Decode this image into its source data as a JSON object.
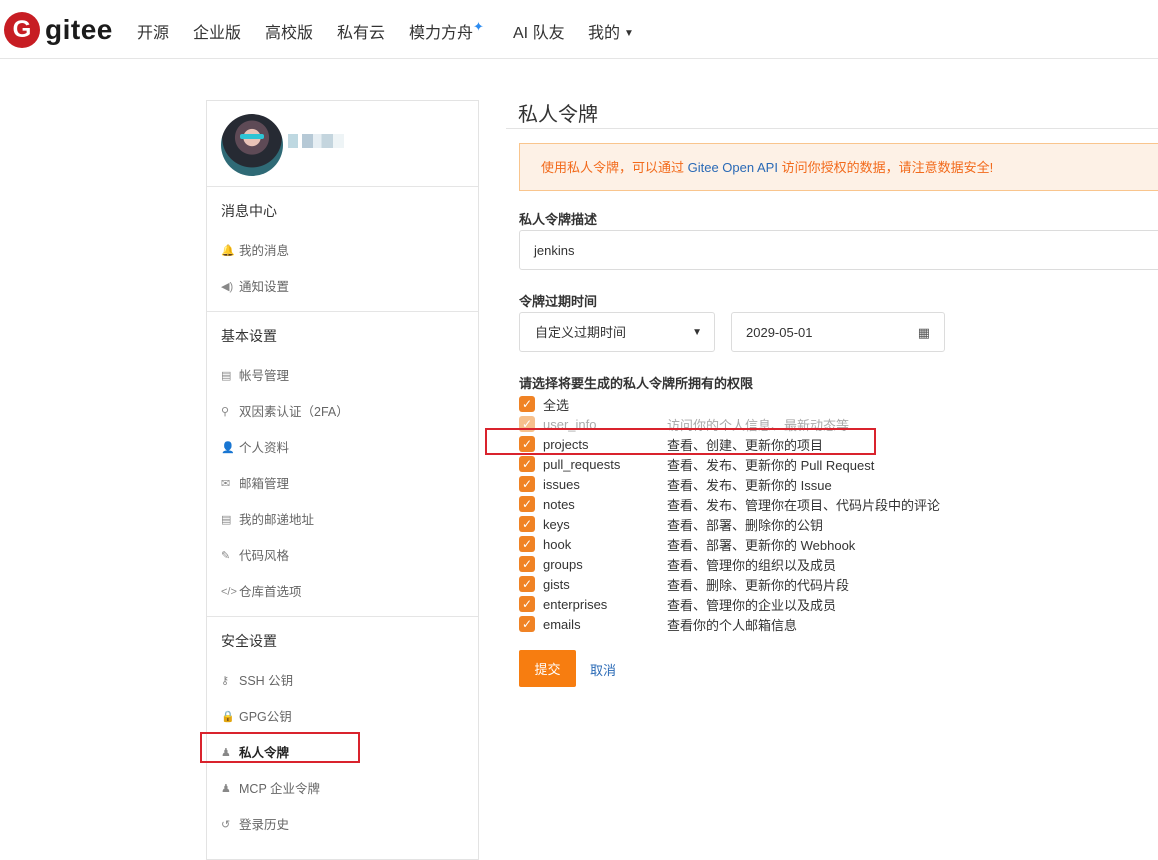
{
  "nav": {
    "brand": "gitee",
    "logo_letter": "G",
    "items": [
      "开源",
      "企业版",
      "高校版",
      "私有云",
      "模力方舟",
      "AI 队友",
      "我的"
    ],
    "spark_icon": "sparkle-icon",
    "dropdown_icon": "caret-down-icon"
  },
  "sidebar": {
    "groups": [
      {
        "title": "消息中心",
        "items": [
          {
            "label": "我的消息",
            "icon": "bell-icon"
          },
          {
            "label": "通知设置",
            "icon": "speaker-icon"
          }
        ]
      },
      {
        "title": "基本设置",
        "items": [
          {
            "label": "帐号管理",
            "icon": "id-card-icon"
          },
          {
            "label": "双因素认证（2FA）",
            "icon": "user-key-icon"
          },
          {
            "label": "个人资料",
            "icon": "user-icon"
          },
          {
            "label": "邮箱管理",
            "icon": "envelope-icon"
          },
          {
            "label": "我的邮递地址",
            "icon": "address-card-icon"
          },
          {
            "label": "代码风格",
            "icon": "brush-icon"
          },
          {
            "label": "仓库首选项",
            "icon": "code-icon"
          }
        ]
      },
      {
        "title": "安全设置",
        "items": [
          {
            "label": "SSH 公钥",
            "icon": "key-icon"
          },
          {
            "label": "GPG公钥",
            "icon": "lock-icon"
          },
          {
            "label": "私人令牌",
            "icon": "user-secret-icon"
          },
          {
            "label": "MCP 企业令牌",
            "icon": "user-secret-icon"
          },
          {
            "label": "登录历史",
            "icon": "history-icon"
          }
        ]
      }
    ]
  },
  "main": {
    "title": "私人令牌",
    "notice_prefix": "使用私人令牌，可以通过 ",
    "notice_link": "Gitee Open API",
    "notice_suffix": " 访问你授权的数据，请注意数据安全!",
    "desc_label": "私人令牌描述",
    "desc_value": "jenkins",
    "expiry_label": "令牌过期时间",
    "expiry_select": "自定义过期时间",
    "expiry_date": "2029-05-01",
    "perm_label": "请选择将要生成的私人令牌所拥有的权限",
    "select_all": "全选",
    "permissions": [
      {
        "name": "user_info",
        "desc": "访问你的个人信息、最新动态等",
        "checked": true,
        "disabled": true
      },
      {
        "name": "projects",
        "desc": "查看、创建、更新你的项目",
        "checked": true,
        "disabled": false
      },
      {
        "name": "pull_requests",
        "desc": "查看、发布、更新你的 Pull Request",
        "checked": true,
        "disabled": false
      },
      {
        "name": "issues",
        "desc": "查看、发布、更新你的 Issue",
        "checked": true,
        "disabled": false
      },
      {
        "name": "notes",
        "desc": "查看、发布、管理你在项目、代码片段中的评论",
        "checked": true,
        "disabled": false
      },
      {
        "name": "keys",
        "desc": "查看、部署、删除你的公钥",
        "checked": true,
        "disabled": false
      },
      {
        "name": "hook",
        "desc": "查看、部署、更新你的 Webhook",
        "checked": true,
        "disabled": false
      },
      {
        "name": "groups",
        "desc": "查看、管理你的组织以及成员",
        "checked": true,
        "disabled": false
      },
      {
        "name": "gists",
        "desc": "查看、删除、更新你的代码片段",
        "checked": true,
        "disabled": false
      },
      {
        "name": "enterprises",
        "desc": "查看、管理你的企业以及成员",
        "checked": true,
        "disabled": false
      },
      {
        "name": "emails",
        "desc": "查看你的个人邮箱信息",
        "checked": true,
        "disabled": false
      }
    ],
    "submit": "提交",
    "cancel": "取消"
  },
  "colors": {
    "accent": "#f77d10",
    "brand": "#c71d23",
    "link": "#2a6ab6",
    "highlight": "#d9232d"
  }
}
